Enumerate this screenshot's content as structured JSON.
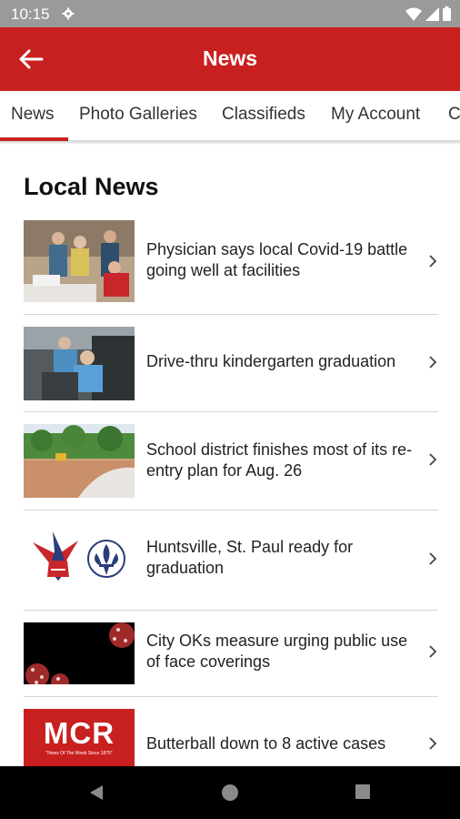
{
  "status_bar": {
    "time": "10:15"
  },
  "app_bar": {
    "title": "News",
    "back_icon": "arrow-left-icon",
    "bg_color": "#c8201f"
  },
  "tabs": [
    {
      "label": "News",
      "selected": true
    },
    {
      "label": "Photo Galleries",
      "selected": false
    },
    {
      "label": "Classifieds",
      "selected": false
    },
    {
      "label": "My Account",
      "selected": false
    },
    {
      "label": "C",
      "selected": false
    }
  ],
  "section": {
    "title": "Local News"
  },
  "articles": [
    {
      "headline": "Physician says local Covid-19 battle going well at facilities"
    },
    {
      "headline": "Drive-thru kindergarten graduation"
    },
    {
      "headline": "School district finishes most of its re-entry plan for Aug. 26"
    },
    {
      "headline": "Huntsville, St. Paul ready for graduation"
    },
    {
      "headline": "City OKs measure urging public use of face coverings"
    },
    {
      "headline": "Butterball down to 8 active cases"
    }
  ],
  "logo": {
    "text": "MCR",
    "tagline": "\"News Of The Week Since 1879\""
  },
  "icons": {
    "chevron": "chevron-right-icon",
    "nav_back": "triangle-back-icon",
    "nav_home": "circle-home-icon",
    "nav_recents": "square-recents-icon"
  }
}
